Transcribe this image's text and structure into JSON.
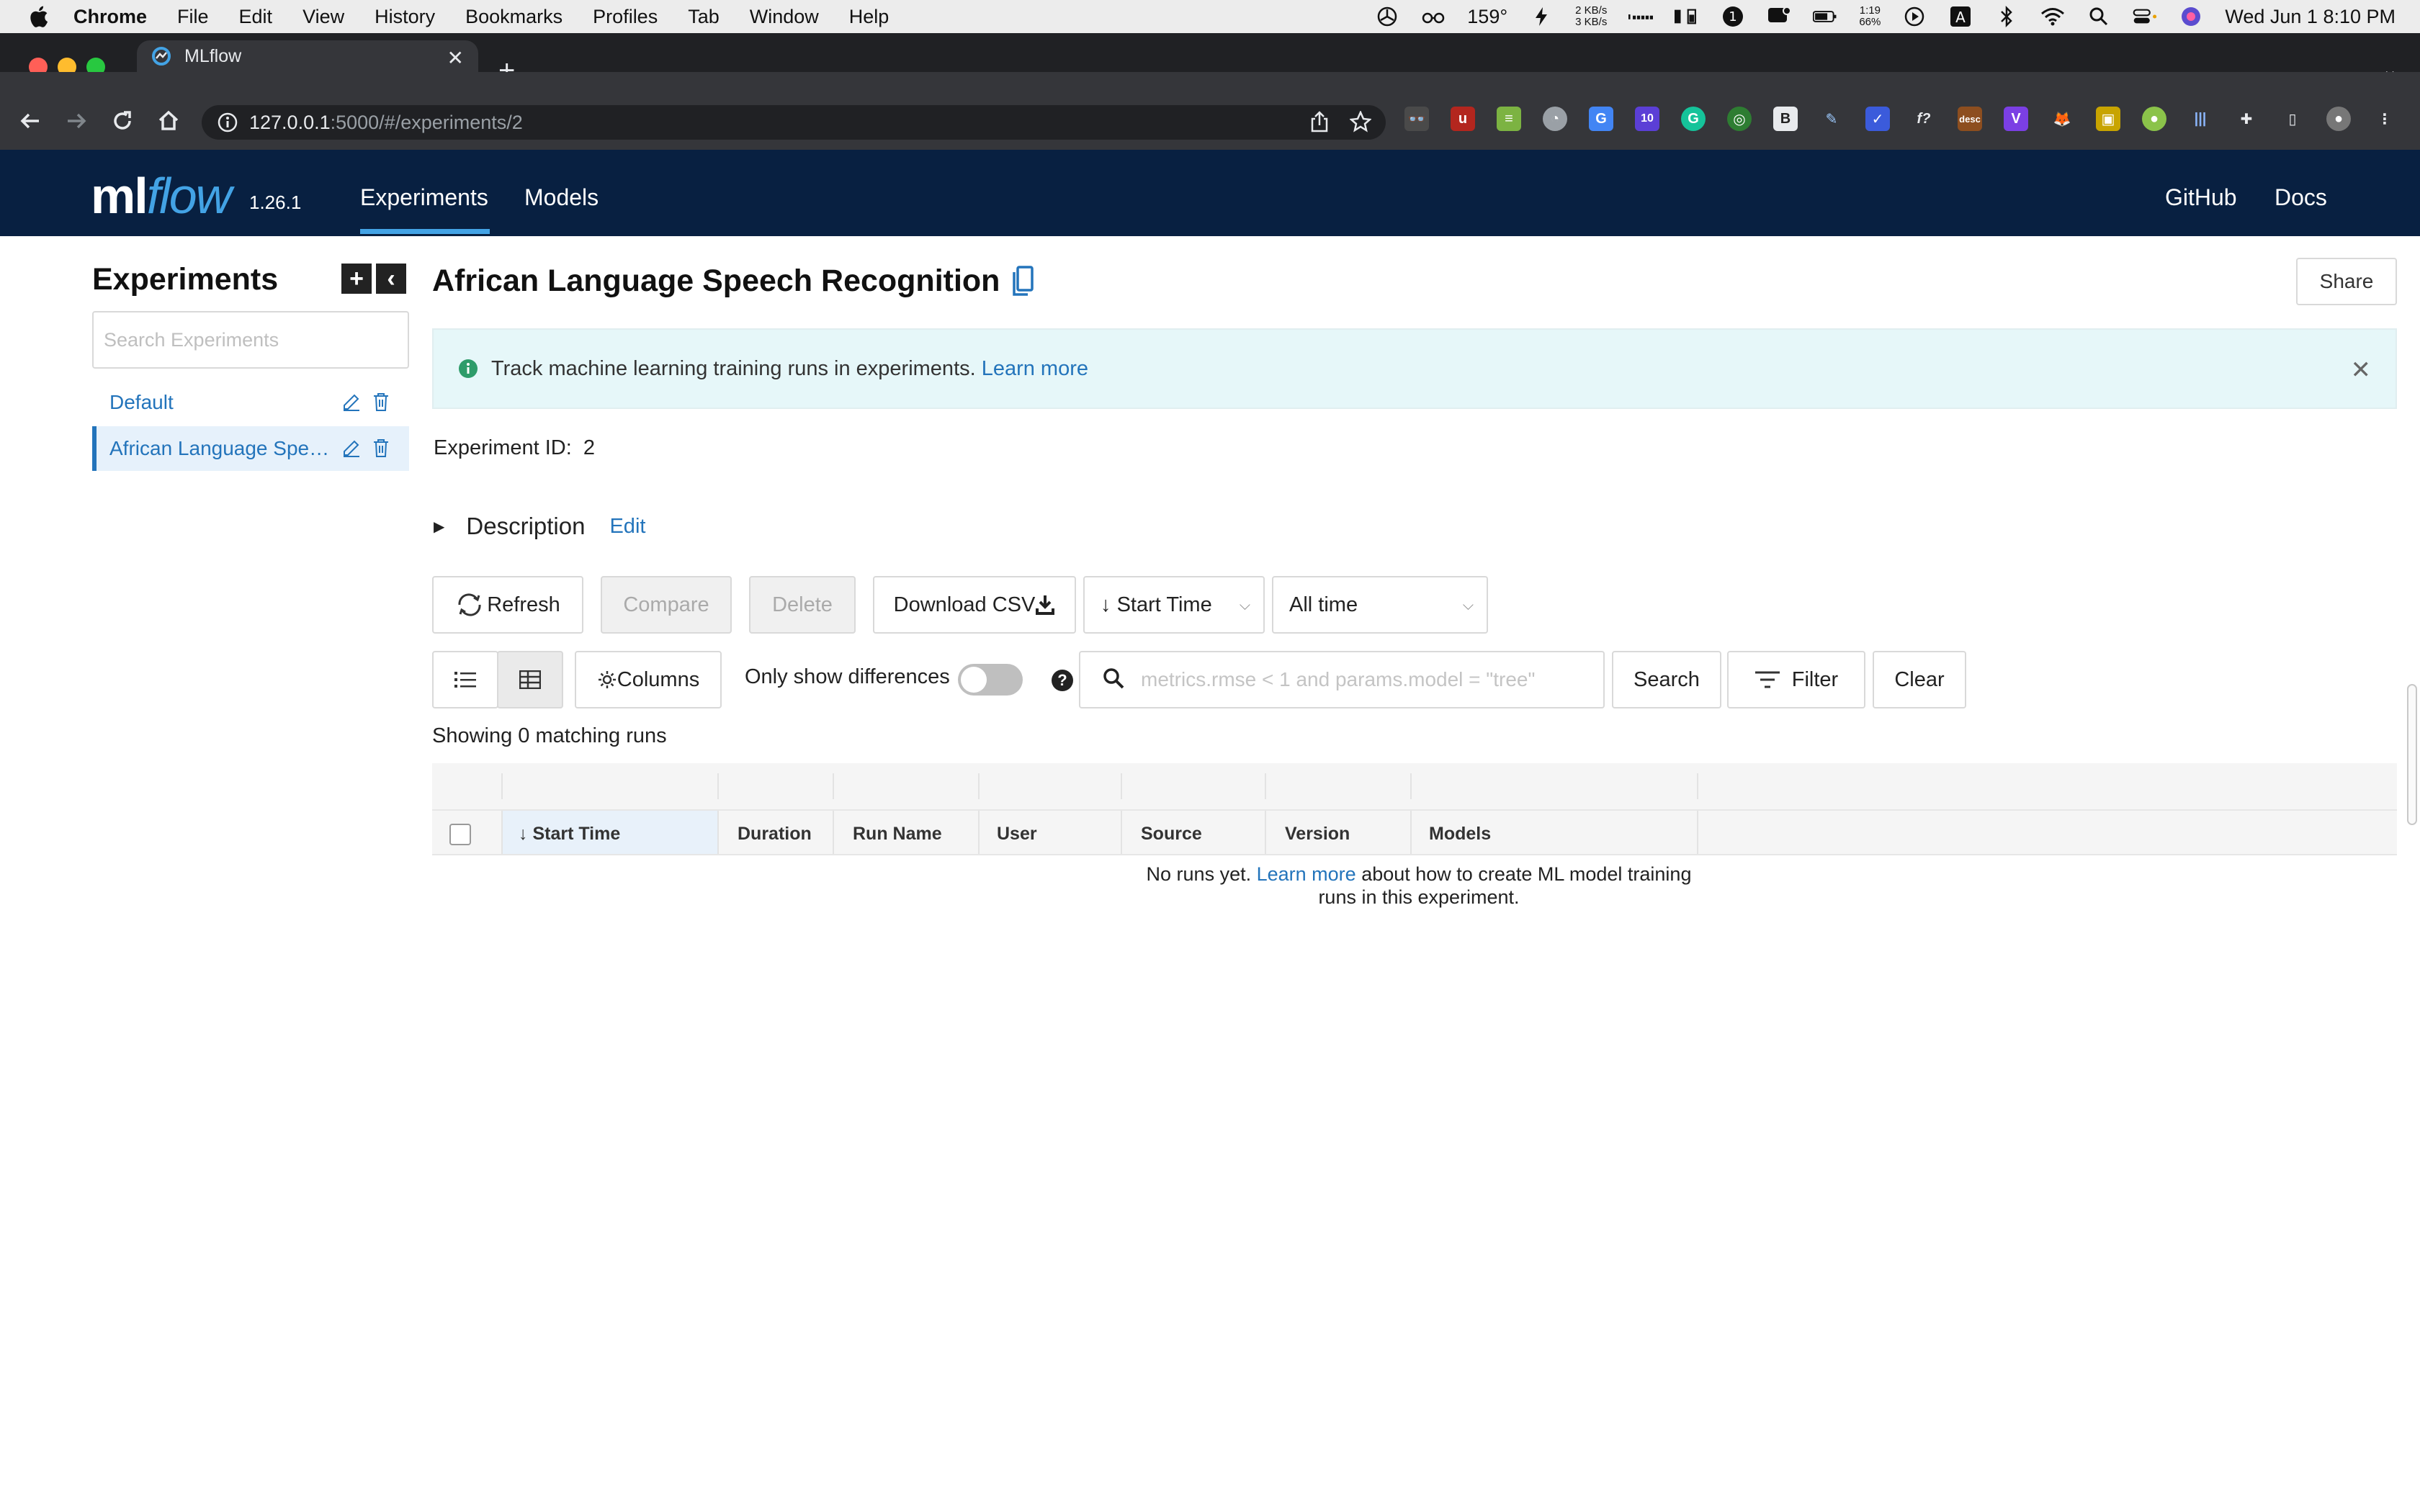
{
  "menubar": {
    "app": "Chrome",
    "items": [
      "File",
      "Edit",
      "View",
      "History",
      "Bookmarks",
      "Profiles",
      "Tab",
      "Window",
      "Help"
    ],
    "temperature": "159°",
    "net_up": "2 KB/s",
    "net_down": "3 KB/s",
    "battery_time": "1:19",
    "battery_pct": "66%",
    "datetime": "Wed Jun 1  8:10 PM"
  },
  "browser": {
    "tab_title": "MLflow",
    "url_host": "127.0.0.1",
    "url_rest": ":5000/#/experiments/2",
    "ext_badge": "10",
    "ext_desc": "desc"
  },
  "header": {
    "logo_ml": "ml",
    "logo_flow": "flow",
    "version": "1.26.1",
    "nav": [
      "Experiments",
      "Models"
    ],
    "right_links": [
      "GitHub",
      "Docs"
    ]
  },
  "sidebar": {
    "title": "Experiments",
    "search_placeholder": "Search Experiments",
    "experiments": [
      "Default",
      "African Language Speech Recognition"
    ]
  },
  "main": {
    "title": "African Language Speech Recognition",
    "share": "Share",
    "banner_text": "Track machine learning training runs in experiments.",
    "banner_link": "Learn more",
    "experiment_id_label": "Experiment ID:",
    "experiment_id": "2",
    "description_label": "Description",
    "description_edit": "Edit",
    "buttons": {
      "refresh": "Refresh",
      "compare": "Compare",
      "delete": "Delete",
      "download": "Download CSV",
      "sort": "Start Time",
      "time_range": "All time",
      "columns": "Columns",
      "search": "Search",
      "filter": "Filter",
      "clear": "Clear"
    },
    "toggle_label": "Only show differences",
    "search_placeholder": "metrics.rmse < 1 and params.model = \"tree\"",
    "showing": "Showing 0 matching runs",
    "columns": [
      "Start Time",
      "Duration",
      "Run Name",
      "User",
      "Source",
      "Version",
      "Models"
    ],
    "empty_prefix": "No runs yet.",
    "empty_link": "Learn more",
    "empty_suffix": "about how to create ML model training runs in this experiment."
  },
  "colors": {
    "header_bg": "#082041",
    "accent": "#43a3e5",
    "link": "#2374bb",
    "banner_bg": "#e6f7f9"
  }
}
